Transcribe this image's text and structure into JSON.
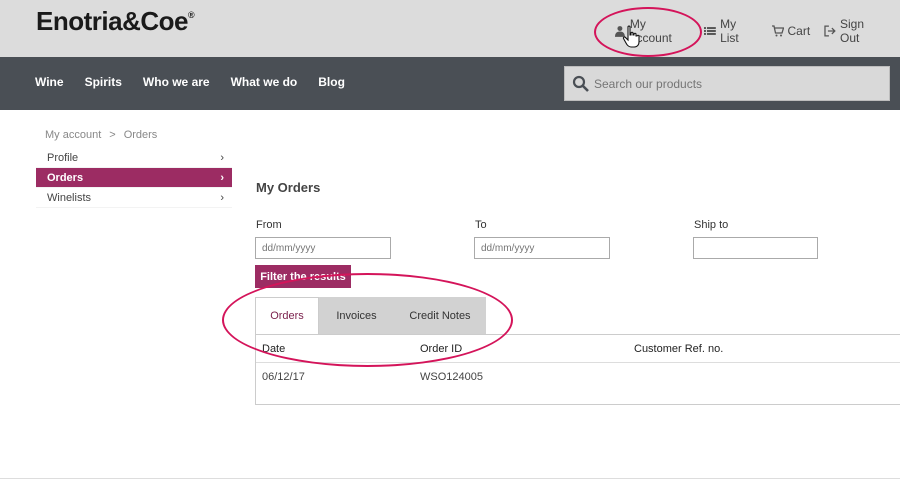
{
  "header": {
    "logo": "Enotria&Coe",
    "logo_mark": "®",
    "links": [
      {
        "label": "My account",
        "icon": "user-icon"
      },
      {
        "label": "My List",
        "icon": "list-icon"
      },
      {
        "label": "Cart",
        "icon": "cart-icon"
      },
      {
        "label": "Sign Out",
        "icon": "sign-out-icon"
      }
    ]
  },
  "nav": {
    "items": [
      "Wine",
      "Spirits",
      "Who we are",
      "What we do",
      "Blog"
    ],
    "search_placeholder": "Search our products"
  },
  "breadcrumb": {
    "items": [
      "My account",
      "Orders"
    ],
    "separator": ">"
  },
  "sidebar": {
    "items": [
      {
        "label": "Profile",
        "active": false
      },
      {
        "label": "Orders",
        "active": true
      },
      {
        "label": "Winelists",
        "active": false
      }
    ],
    "chevron": "›"
  },
  "orders": {
    "title": "My Orders",
    "filters": {
      "from_label": "From",
      "from_placeholder": "dd/mm/yyyy",
      "to_label": "To",
      "to_placeholder": "dd/mm/yyyy",
      "shipto_label": "Ship to",
      "shipto_value": ""
    },
    "filter_button": "Filter the results",
    "tabs": [
      {
        "label": "Orders",
        "active": true
      },
      {
        "label": "Invoices",
        "active": false
      },
      {
        "label": "Credit Notes",
        "active": false
      }
    ],
    "table": {
      "columns": [
        "Date",
        "Order ID",
        "Customer Ref. no."
      ],
      "rows": [
        [
          "06/12/17",
          "WSO124005",
          ""
        ]
      ]
    }
  },
  "colors": {
    "accent": "#9c2c63",
    "topbar": "#dcdcdc",
    "navbar": "#4a4f55",
    "annotation": "#d4145a"
  }
}
